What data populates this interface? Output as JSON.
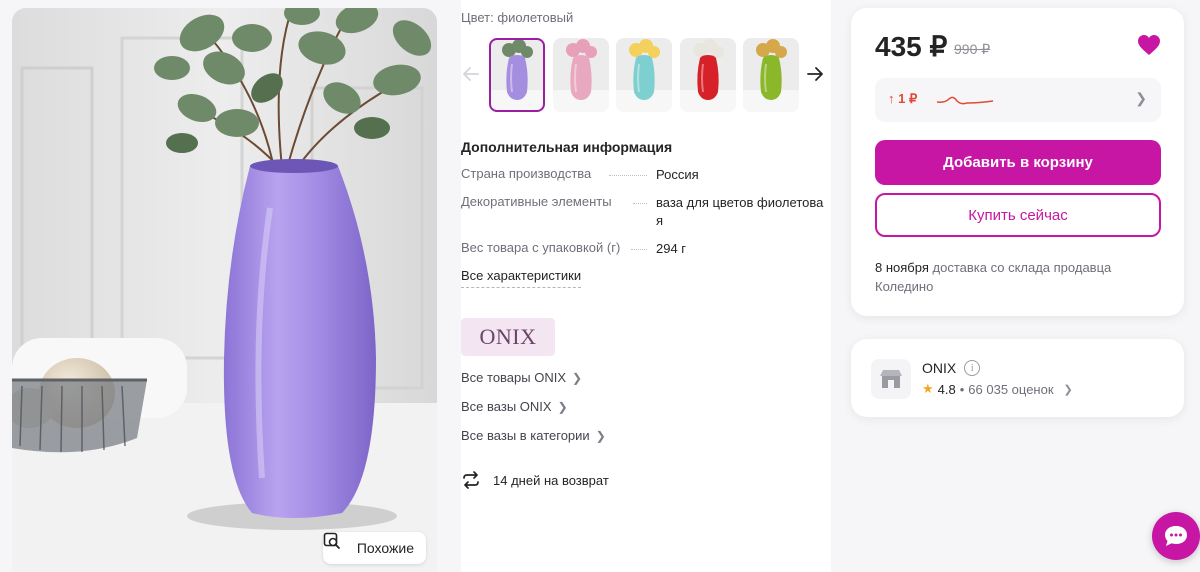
{
  "photo": {
    "alt": "",
    "similar_label": "Похожие"
  },
  "color": {
    "label": "Цвет:",
    "value": "фиолетовый",
    "thumbnails": [
      {
        "name": "purple",
        "vase": "#a58ee0"
      },
      {
        "name": "pink",
        "vase": "#e8a8c0"
      },
      {
        "name": "teal",
        "vase": "#7ecfcf"
      },
      {
        "name": "red",
        "vase": "#d72128"
      },
      {
        "name": "green",
        "vase": "#8ab82a"
      }
    ]
  },
  "details": {
    "heading": "Дополнительная информация",
    "rows": [
      {
        "key": "Страна производства",
        "value": "Россия"
      },
      {
        "key": "Декоративные элементы",
        "value": "ваза для цветов фиолетова я"
      },
      {
        "key": "Вес товара с упаковкой (г)",
        "value": "294 г"
      }
    ],
    "all_specs": "Все характеристики"
  },
  "brand": {
    "logo_text": "ONIX",
    "links": [
      "Все товары ONIX",
      "Все вазы ONIX",
      "Все вазы в категории"
    ],
    "returns": "14 дней на возврат"
  },
  "pricing": {
    "price": "435 ₽",
    "old_price": "990 ₽",
    "trend": "↑ 1 ₽",
    "add_to_cart": "Добавить в корзину",
    "buy_now": "Купить сейчас",
    "delivery_date": "8 ноября",
    "delivery_text": "доставка со склада продавца Коледино",
    "accent": "#c716a4"
  },
  "seller": {
    "name": "ONIX",
    "info": "i",
    "star": "★",
    "rating": "4.8",
    "separator": "•",
    "reviews": "66 035 оценок"
  }
}
